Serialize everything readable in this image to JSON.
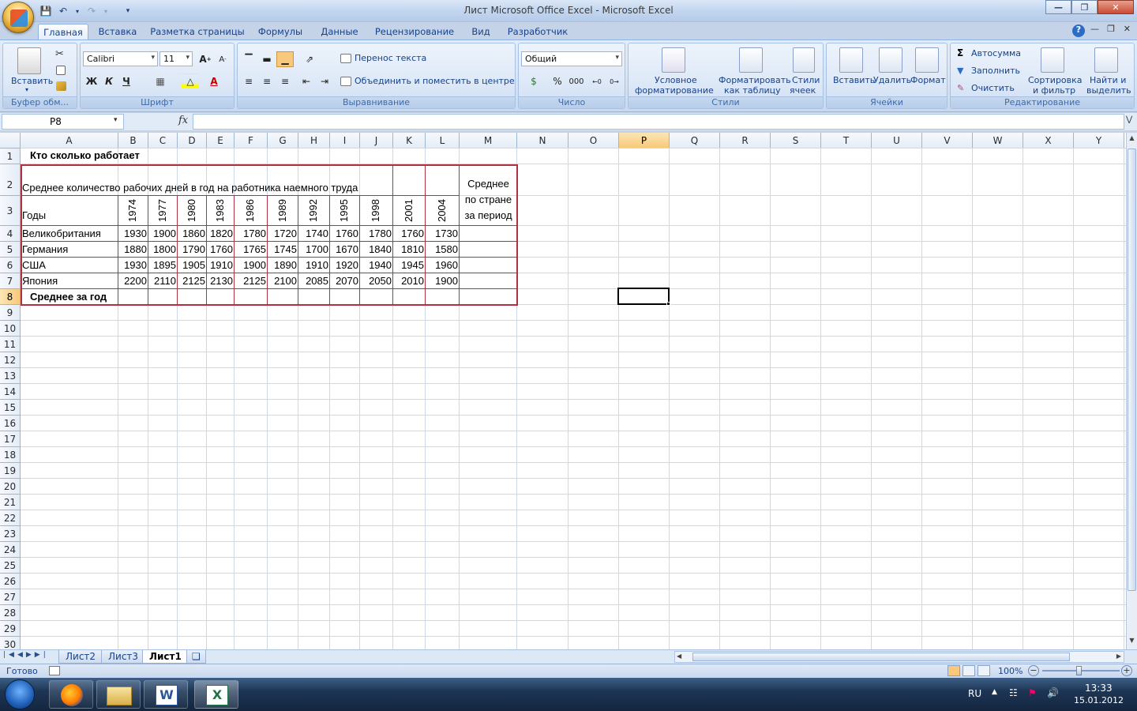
{
  "window": {
    "title": "Лист Microsoft Office Excel - Microsoft Excel"
  },
  "qat": {
    "save_icon": "save-icon",
    "undo_icon": "undo-icon",
    "redo_icon": "redo-icon"
  },
  "ribbon_tabs": [
    "Главная",
    "Вставка",
    "Разметка страницы",
    "Формулы",
    "Данные",
    "Рецензирование",
    "Вид",
    "Разработчик"
  ],
  "ribbon": {
    "clipboard": {
      "paste": "Вставить",
      "label": "Буфер обм..."
    },
    "font": {
      "name": "Calibri",
      "size": "11",
      "bold": "Ж",
      "italic": "К",
      "underline": "Ч",
      "label": "Шрифт"
    },
    "alignment": {
      "wrap": "Перенос текста",
      "merge": "Объединить и поместить в центре",
      "label": "Выравнивание"
    },
    "number": {
      "format": "Общий",
      "percent": "%",
      "thousands": "000",
      "label": "Число"
    },
    "styles": {
      "conditional_1": "Условное",
      "conditional_2": "форматирование",
      "table_1": "Форматировать",
      "table_2": "как таблицу",
      "cell_1": "Стили",
      "cell_2": "ячеек",
      "label": "Стили"
    },
    "cells": {
      "insert": "Вставить",
      "delete": "Удалить",
      "format": "Формат",
      "label": "Ячейки"
    },
    "editing": {
      "autosum": "Автосумма",
      "fill": "Заполнить",
      "clear": "Очистить",
      "sort_1": "Сортировка",
      "sort_2": "и фильтр",
      "find_1": "Найти и",
      "find_2": "выделить",
      "label": "Редактирование"
    }
  },
  "formula_bar": {
    "name_box": "P8",
    "fx": "fx",
    "value": ""
  },
  "columns": [
    "A",
    "B",
    "C",
    "D",
    "E",
    "F",
    "G",
    "H",
    "I",
    "J",
    "K",
    "L",
    "M",
    "N",
    "O",
    "P",
    "Q",
    "R",
    "S",
    "T",
    "U",
    "V",
    "W",
    "X",
    "Y"
  ],
  "rows": [
    "1",
    "2",
    "3",
    "4",
    "5",
    "6",
    "7",
    "8",
    "9",
    "10",
    "11",
    "12",
    "13",
    "14",
    "15",
    "16",
    "17",
    "18",
    "19",
    "20",
    "21",
    "22",
    "23",
    "24",
    "25",
    "26",
    "27",
    "28",
    "29",
    "30"
  ],
  "selected": {
    "column": "P",
    "row": "8"
  },
  "sheet": {
    "title": "Кто сколько работает",
    "subtitle": "Среднее количество рабочих дней в год на работника наемного труда",
    "years_label": "Годы",
    "avg_country_1": "Среднее",
    "avg_country_2": "по стране",
    "avg_country_3": "за период",
    "years": [
      "1974",
      "1977",
      "1980",
      "1983",
      "1986",
      "1989",
      "1992",
      "1995",
      "1998",
      "2001",
      "2004"
    ],
    "data": [
      {
        "country": "Великобритания",
        "values": [
          "1930",
          "1900",
          "1860",
          "1820",
          "1780",
          "1720",
          "1740",
          "1760",
          "1780",
          "1760",
          "1730"
        ]
      },
      {
        "country": "Германия",
        "values": [
          "1880",
          "1800",
          "1790",
          "1760",
          "1765",
          "1745",
          "1700",
          "1670",
          "1840",
          "1810",
          "1580"
        ]
      },
      {
        "country": "США",
        "values": [
          "1930",
          "1895",
          "1905",
          "1910",
          "1900",
          "1890",
          "1910",
          "1920",
          "1940",
          "1945",
          "1960"
        ]
      },
      {
        "country": "Япония",
        "values": [
          "2200",
          "2110",
          "2125",
          "2130",
          "2125",
          "2100",
          "2085",
          "2070",
          "2050",
          "2010",
          "1900"
        ]
      }
    ],
    "avg_year": "Среднее за год"
  },
  "sheet_tabs": [
    "Лист2",
    "Лист3",
    "Лист1"
  ],
  "active_sheet": "Лист1",
  "status": {
    "ready": "Готово",
    "zoom": "100%"
  },
  "taskbar": {
    "lang": "RU",
    "time": "13:33",
    "date": "15.01.2012"
  }
}
